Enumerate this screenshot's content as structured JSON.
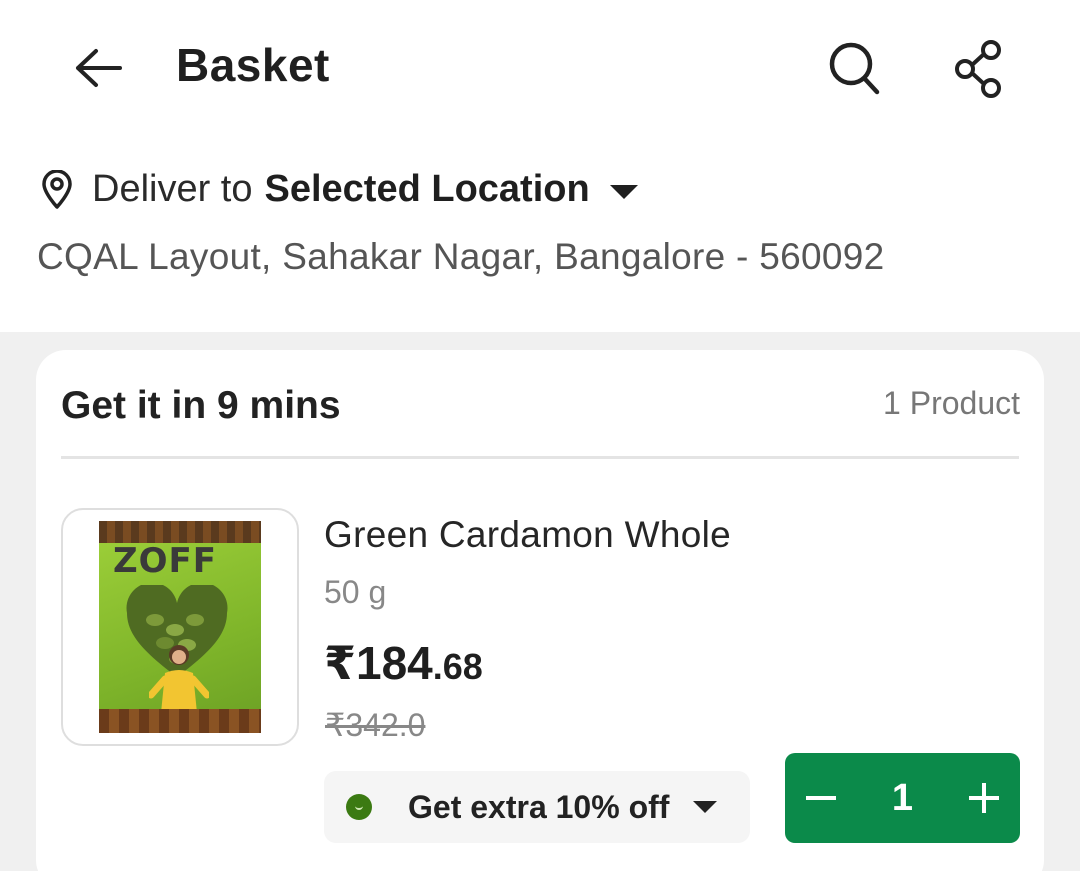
{
  "header": {
    "title": "Basket",
    "back_icon": "arrow-left-icon",
    "search_icon": "search-icon",
    "share_icon": "share-icon"
  },
  "location": {
    "prefix": "Deliver to",
    "selected": "Selected Location",
    "address": "CQAL Layout, Sahakar Nagar, Bangalore - 560092"
  },
  "basket": {
    "eta": "Get it in 9 mins",
    "count": "1 Product",
    "items": [
      {
        "name": "Green Cardamon Whole",
        "weight": "50 g",
        "price_symbol": "₹",
        "price_int": "184",
        "price_dec": ".68",
        "mrp": "₹342.0",
        "brand": "ZOFF",
        "offer": "Get extra 10% off",
        "quantity": "1"
      }
    ]
  },
  "colors": {
    "accent_green": "#0b8a4a",
    "offer_dot": "#3b7a12",
    "page_gray": "#f0f0f0"
  }
}
